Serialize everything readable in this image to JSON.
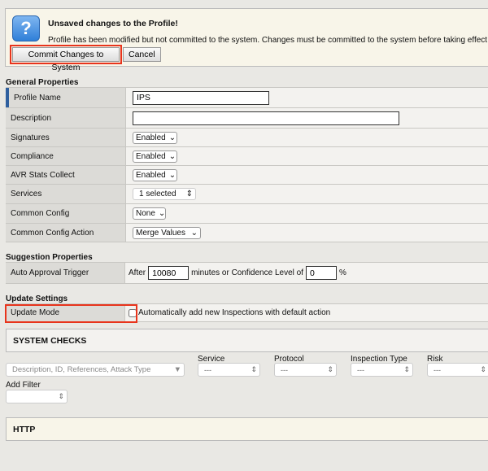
{
  "banner": {
    "icon": "question-icon",
    "title": "Unsaved changes to the Profile!",
    "message": "Profile has been modified but not committed to the system. Changes must be committed to the system before taking effect.",
    "commit_label": "Commit Changes to System",
    "cancel_label": "Cancel"
  },
  "general": {
    "title": "General Properties",
    "profile_name_label": "Profile Name",
    "profile_name": "IPS",
    "description_label": "Description",
    "description": "",
    "signatures_label": "Signatures",
    "signatures": "Enabled",
    "compliance_label": "Compliance",
    "compliance": "Enabled",
    "avr_label": "AVR Stats Collect",
    "avr": "Enabled",
    "services_label": "Services",
    "services": "1 selected",
    "common_config_label": "Common Config",
    "common_config": "None",
    "common_config_action_label": "Common Config Action",
    "common_config_action": "Merge Values"
  },
  "suggestion": {
    "title": "Suggestion Properties",
    "trigger_label": "Auto Approval Trigger",
    "after": "After",
    "minutes": "10080",
    "middle": "minutes or Confidence Level of",
    "confidence": "0",
    "percent": "%"
  },
  "update": {
    "title": "Update Settings",
    "mode_label": "Update Mode",
    "checkbox_label": "Automatically add new Inspections with default action",
    "checked": false
  },
  "system_checks": {
    "title": "SYSTEM CHECKS",
    "search_placeholder": "Description, ID, References, Attack Type",
    "service_label": "Service",
    "service": "---",
    "protocol_label": "Protocol",
    "protocol": "---",
    "inspection_type_label": "Inspection Type",
    "inspection_type": "---",
    "risk_label": "Risk",
    "risk": "---",
    "add_filter_label": "Add Filter",
    "add_filter": ""
  },
  "http": {
    "title": "HTTP"
  }
}
